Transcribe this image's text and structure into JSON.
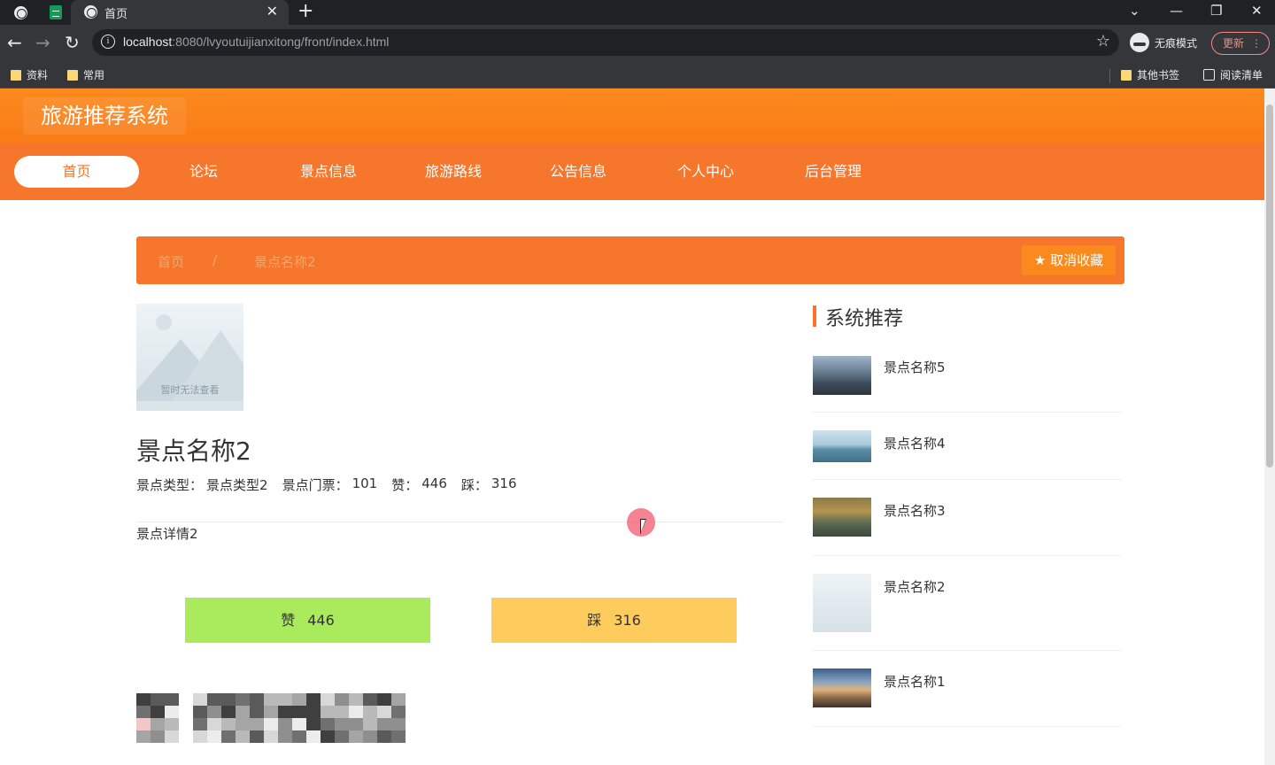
{
  "browser": {
    "tab_title": "首页",
    "url_host": "localhost",
    "url_rest": ":8080/lvyoutuijianxitong/front/index.html",
    "incognito_label": "无痕模式",
    "update_label": "更新",
    "bookmarks": [
      "资料",
      "常用"
    ],
    "other_bookmarks": "其他书签",
    "reading_list": "阅读清单"
  },
  "site": {
    "title": "旅游推荐系统",
    "nav": [
      "首页",
      "论坛",
      "景点信息",
      "旅游路线",
      "公告信息",
      "个人中心",
      "后台管理"
    ]
  },
  "breadcrumb": {
    "home": "首页",
    "separator": "/",
    "current": "景点名称2",
    "favorite_button": "★ 取消收藏"
  },
  "detail": {
    "placeholder_text": "暂时无法查看",
    "name": "景点名称2",
    "type_label": "景点类型：",
    "type_value": "景点类型2",
    "ticket_label": "景点门票：",
    "ticket_value": "101",
    "like_label": "赞：",
    "like_value": "446",
    "dislike_label": "踩：",
    "dislike_value": "316",
    "description": "景点详情2",
    "like_button_label": "赞",
    "like_button_count": "446",
    "dislike_button_label": "踩",
    "dislike_button_count": "316"
  },
  "recommend": {
    "title": "系统推荐",
    "items": [
      {
        "name": "景点名称5"
      },
      {
        "name": "景点名称4"
      },
      {
        "name": "景点名称3"
      },
      {
        "name": "景点名称2"
      },
      {
        "name": "景点名称1"
      }
    ]
  },
  "colors": {
    "header_orange": "#fb8a1e",
    "nav_orange": "#f6762c",
    "like_green": "#a9eb5c",
    "dislike_yellow": "#fecb5d"
  }
}
